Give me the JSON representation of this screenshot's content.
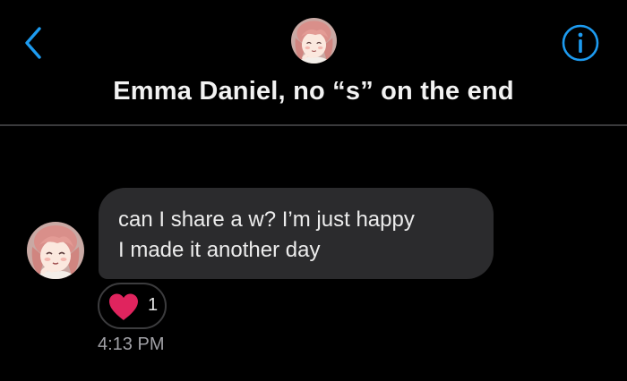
{
  "header": {
    "title": "Emma Daniel, no “s” on the end",
    "back_icon": "chevron-left-icon",
    "info_icon": "info-circle-icon",
    "accent_color": "#1d9bf0"
  },
  "message": {
    "lines": [
      "can I share a w? I’m just happy",
      "I made it another day"
    ],
    "bubble_color": "#2b2b2d",
    "reaction": {
      "icon": "heart-icon",
      "count": "1",
      "color": "#e0245e"
    },
    "timestamp": "4:13 PM"
  }
}
